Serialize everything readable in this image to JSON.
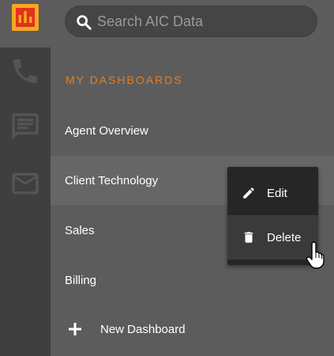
{
  "search": {
    "placeholder": "Search AIC Data"
  },
  "rail": {
    "items": [
      {
        "icon": "bar-chart-icon",
        "active": true,
        "color": "#f5a623"
      },
      {
        "icon": "phone-icon",
        "active": false
      },
      {
        "icon": "chat-icon",
        "active": false
      },
      {
        "icon": "mail-icon",
        "active": false
      }
    ]
  },
  "sidebar": {
    "section_title": "MY DASHBOARDS",
    "section_color": "#e67e22",
    "items": [
      {
        "label": "Agent Overview"
      },
      {
        "label": "Client Technology",
        "selected": true
      },
      {
        "label": "Sales"
      },
      {
        "label": "Billing"
      }
    ],
    "new_dashboard_label": "New Dashboard"
  },
  "context_menu": {
    "items": [
      {
        "label": "Edit",
        "icon": "pencil-icon"
      },
      {
        "label": "Delete",
        "icon": "trash-icon",
        "hovered": true
      }
    ]
  }
}
